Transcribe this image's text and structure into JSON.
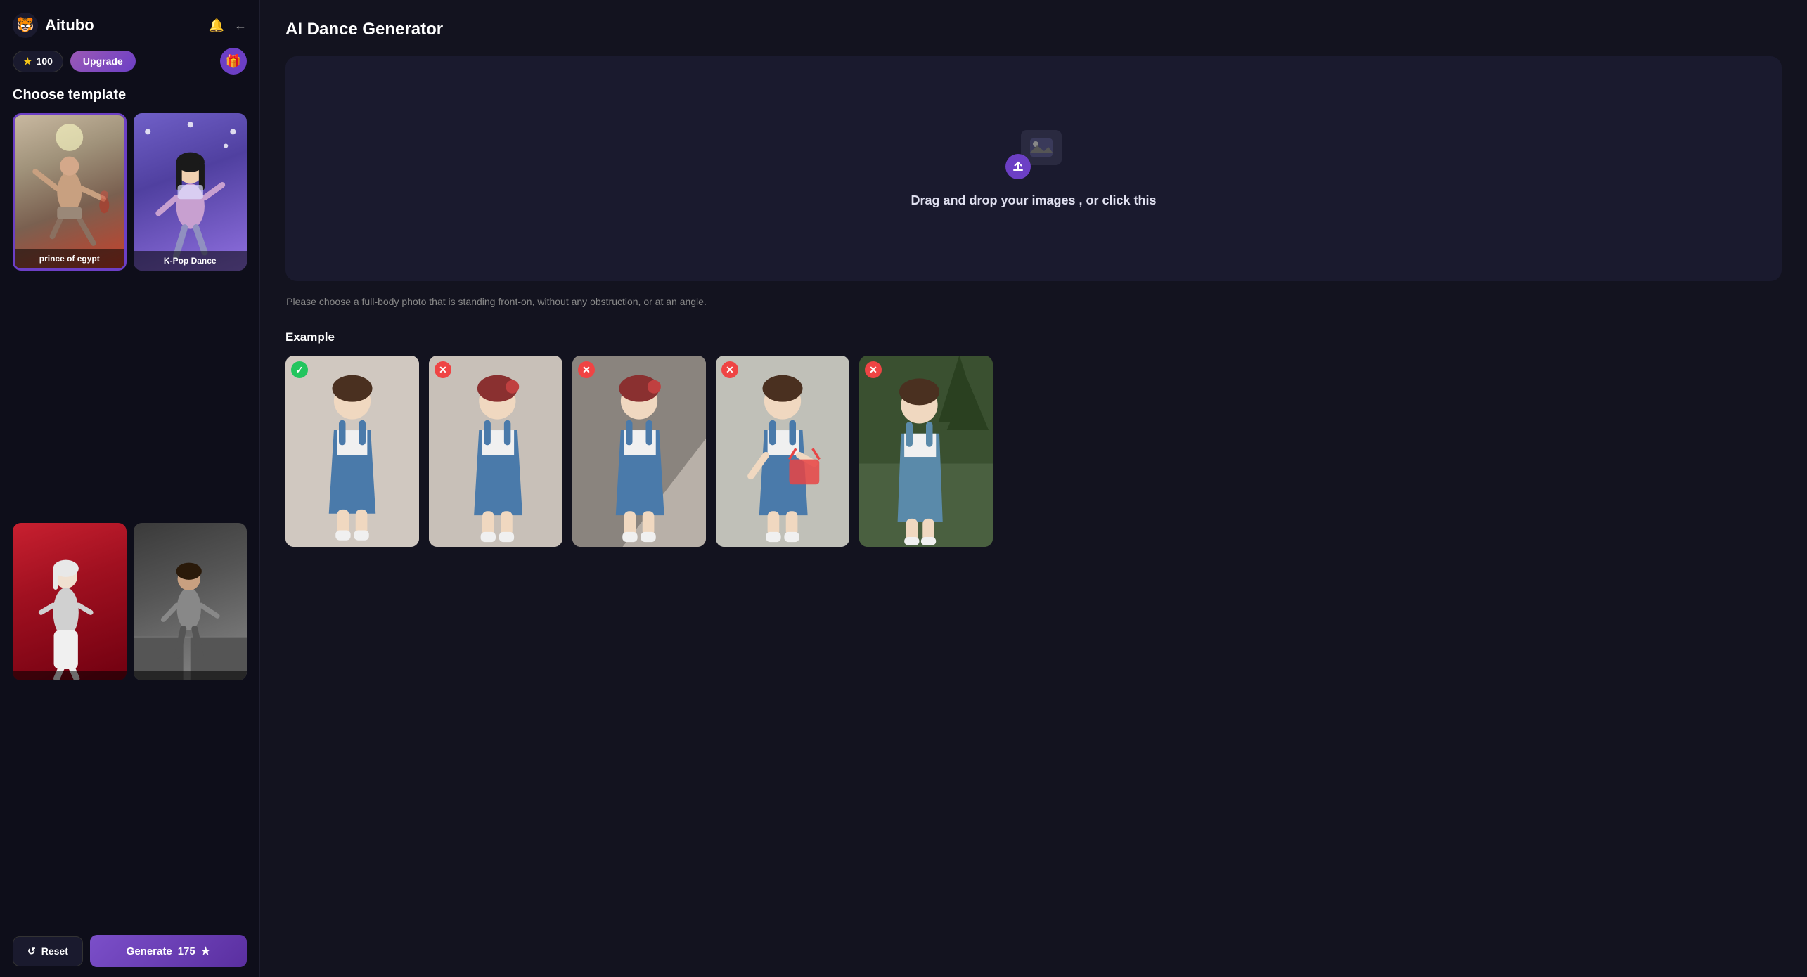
{
  "app": {
    "name": "Aitubo",
    "logo_emoji": "🐯"
  },
  "header": {
    "credits": "100",
    "upgrade_label": "Upgrade",
    "gift_icon": "🎁"
  },
  "sidebar": {
    "choose_template_label": "Choose template",
    "templates": [
      {
        "id": 1,
        "label": "prince of egypt",
        "selected": true
      },
      {
        "id": 2,
        "label": "K-Pop Dance",
        "selected": false
      },
      {
        "id": 3,
        "label": "",
        "selected": false
      },
      {
        "id": 4,
        "label": "",
        "selected": false
      }
    ]
  },
  "bottom_bar": {
    "reset_label": "Reset",
    "generate_label": "Generate",
    "generate_cost": "175"
  },
  "main": {
    "page_title": "AI Dance Generator",
    "upload_text": "Drag and drop your images , or click this",
    "upload_hint": "Please choose a full-body photo that is standing front-on, without any obstruction, or at an angle.",
    "example_title": "Example",
    "examples": [
      {
        "id": 1,
        "status": "good"
      },
      {
        "id": 2,
        "status": "bad"
      },
      {
        "id": 3,
        "status": "bad"
      },
      {
        "id": 4,
        "status": "bad"
      },
      {
        "id": 5,
        "status": "bad"
      }
    ]
  },
  "colors": {
    "accent": "#6c3fc5",
    "bg_primary": "#0e0e1a",
    "bg_secondary": "#1a1a2e",
    "bg_main": "#13131f"
  }
}
